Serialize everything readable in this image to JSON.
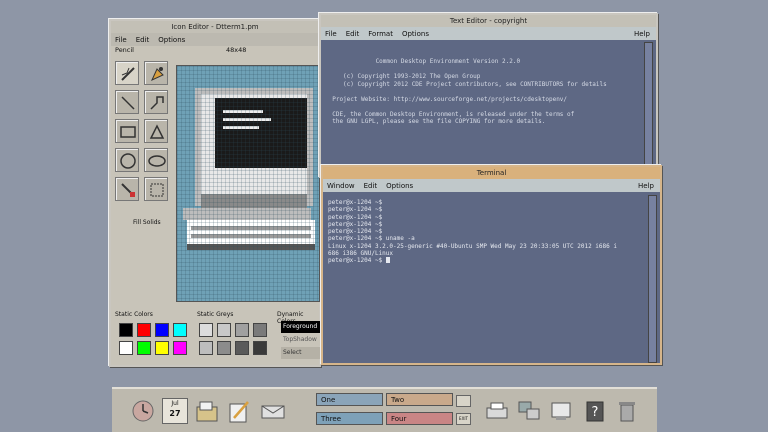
{
  "icon_editor": {
    "title": "Icon Editor - Dtterm1.pm",
    "menu": [
      "File",
      "Edit",
      "Options"
    ],
    "tool_name": "Pencil",
    "size": "48x48",
    "fill_label": "Fill Solids",
    "static_colors_label": "Static Colors",
    "static_greys_label": "Static Greys",
    "dynamic_colors_label": "Dynamic Colors",
    "dynamic_colors": [
      "Foreground",
      "TopShadow",
      "Select"
    ],
    "static_colors": [
      "#000000",
      "#ff0000",
      "#0000ff",
      "#00ffff",
      "#ffffff",
      "#00ff00",
      "#ffff00",
      "#ff00ff"
    ],
    "static_greys": [
      "#dcdcdc",
      "#c8c8c8",
      "#a0a0a0",
      "#7a7a7a",
      "#bdbdbd",
      "#8c8c8c",
      "#5a5a5a",
      "#3a3a3a"
    ]
  },
  "text_editor": {
    "title": "Text Editor - copyright",
    "menu": [
      "File",
      "Edit",
      "Format",
      "Options"
    ],
    "help": "Help",
    "lines": [
      "",
      "",
      "              Common Desktop Environment Version 2.2.0",
      "",
      "     (c) Copyright 1993-2012 The Open Group",
      "     (c) Copyright 2012 CDE Project contributors, see CONTRIBUTORS for details",
      "",
      "  Project Website: http://www.sourceforge.net/projects/cdesktopenv/",
      "",
      "  CDE, the Common Desktop Environment, is released under the terms of",
      "  the GNU LGPL, please see the file COPYING for more details."
    ]
  },
  "terminal": {
    "title": "Terminal",
    "menu": [
      "Window",
      "Edit",
      "Options"
    ],
    "help": "Help",
    "lines": [
      "peter@x-1204 ~$",
      "peter@x-1204 ~$",
      "peter@x-1204 ~$",
      "peter@x-1204 ~$",
      "peter@x-1204 ~$",
      "peter@x-1204 ~$ uname -a",
      "Linux x-1204 3.2.0-25-generic #40-Ubuntu SMP Wed May 23 20:33:05 UTC 2012 i686 i",
      "686 i386 GNU/Linux"
    ],
    "prompt": "peter@x-1204 ~$ "
  },
  "panel": {
    "calendar_month": "Jul",
    "calendar_day": "27",
    "workspaces": [
      "One",
      "Two",
      "Three",
      "Four"
    ],
    "exit_label": "EXIT",
    "colors": {
      "one": "#8aa4b9",
      "two": "#c9a98b",
      "three": "#7ea1b8",
      "four": "#c98585"
    }
  }
}
